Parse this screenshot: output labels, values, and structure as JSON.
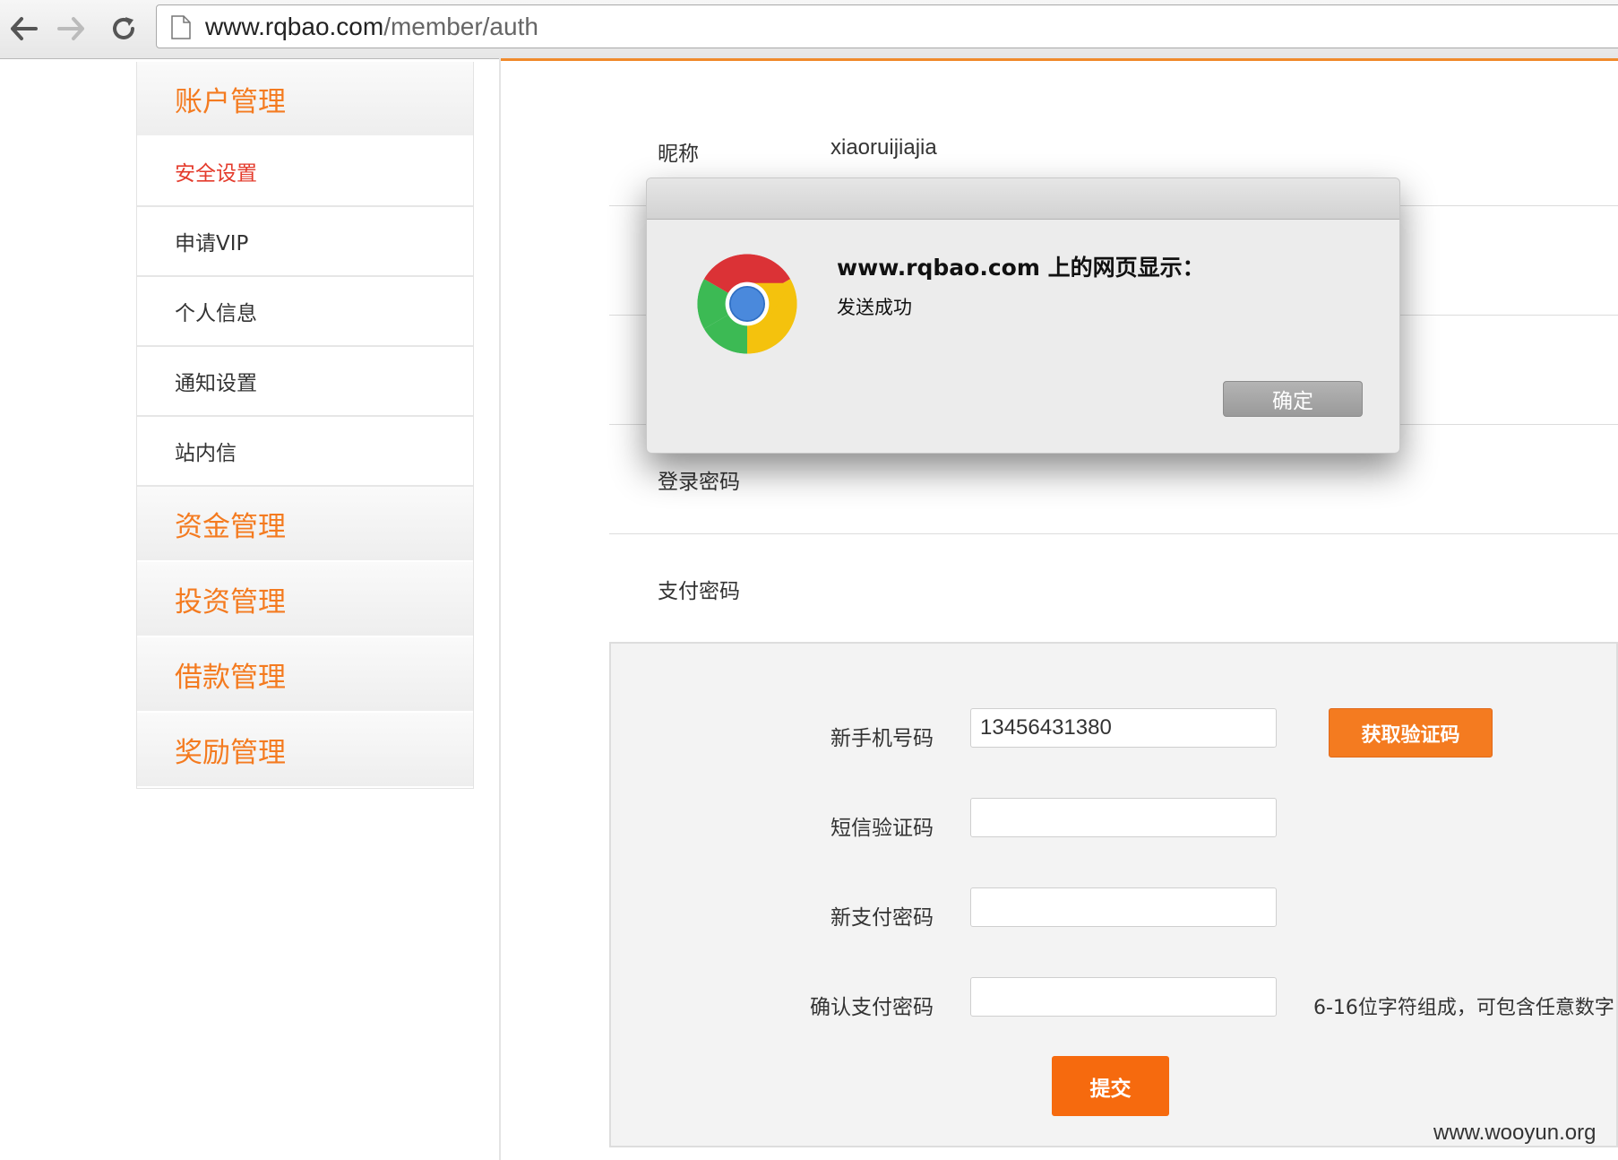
{
  "browser": {
    "url_domain": "www.rqbao.com",
    "url_path": "/member/auth"
  },
  "sidebar": {
    "account_group": "账户管理",
    "items": [
      {
        "label": "安全设置",
        "active": true
      },
      {
        "label": "申请VIP",
        "active": false
      },
      {
        "label": "个人信息",
        "active": false
      },
      {
        "label": "通知设置",
        "active": false
      },
      {
        "label": "站内信",
        "active": false
      }
    ],
    "groups": [
      "资金管理",
      "投资管理",
      "借款管理",
      "奖励管理"
    ]
  },
  "profile": {
    "nickname_label": "昵称",
    "nickname_value": "xiaoruijiajia",
    "login_password_label": "登录密码",
    "pay_password_label": "支付密码"
  },
  "form": {
    "new_phone_label": "新手机号码",
    "new_phone_value": "13456431380",
    "get_code_button": "获取验证码",
    "sms_code_label": "短信验证码",
    "new_pay_password_label": "新支付密码",
    "confirm_pay_password_label": "确认支付密码",
    "password_hint": "6-16位字符组成，可包含任意数字",
    "submit_button": "提交"
  },
  "dialog": {
    "title": "www.rqbao.com 上的网页显示：",
    "message": "发送成功",
    "ok_button": "确定"
  },
  "watermark": "www.wooyun.org",
  "colors": {
    "accent_orange": "#f47b20",
    "active_red": "#e43b2c"
  }
}
